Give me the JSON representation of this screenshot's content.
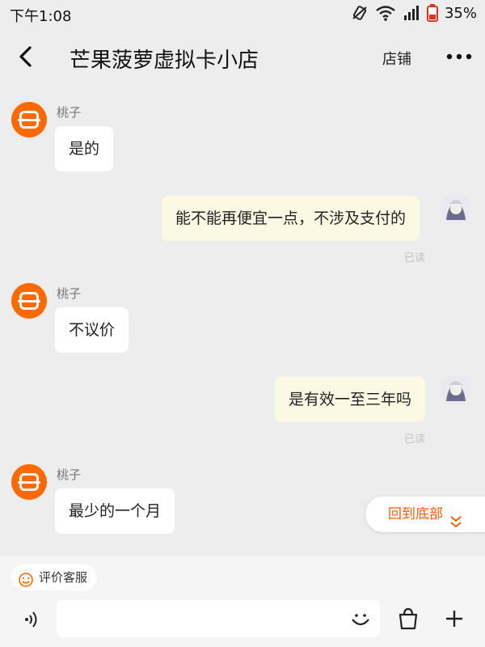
{
  "status_bar": {
    "time": "下午1:08",
    "battery": "35%",
    "icons": [
      "vibrate-off-icon",
      "wifi-icon",
      "signal-icon",
      "battery-icon"
    ]
  },
  "header": {
    "title": "芒果菠萝虚拟卡小店",
    "store_link": "店铺",
    "icons": [
      "back-arrow-icon",
      "more-dots-icon"
    ]
  },
  "messages": [
    {
      "side": "in",
      "sender": "桃子",
      "text": "是的"
    },
    {
      "side": "out",
      "text": "能不能再便宜一点，不涉及支付的",
      "status": "已读"
    },
    {
      "side": "in",
      "sender": "桃子",
      "text": "不议价"
    },
    {
      "side": "out",
      "text": "是有效一至三年吗",
      "status": "已读"
    },
    {
      "side": "in",
      "sender": "桃子",
      "text": "最少的一个月"
    }
  ],
  "jump_to_bottom": "回到底部",
  "bottom_bar": {
    "rate_service": "评价客服",
    "input_value": "",
    "icons": [
      "voice-icon",
      "emoji-icon",
      "bag-icon",
      "plus-icon"
    ]
  },
  "colors": {
    "accent": "#ff6a00",
    "incoming_bubble": "#ffffff",
    "outgoing_bubble": "#fbf9e3",
    "background": "#ededed"
  }
}
